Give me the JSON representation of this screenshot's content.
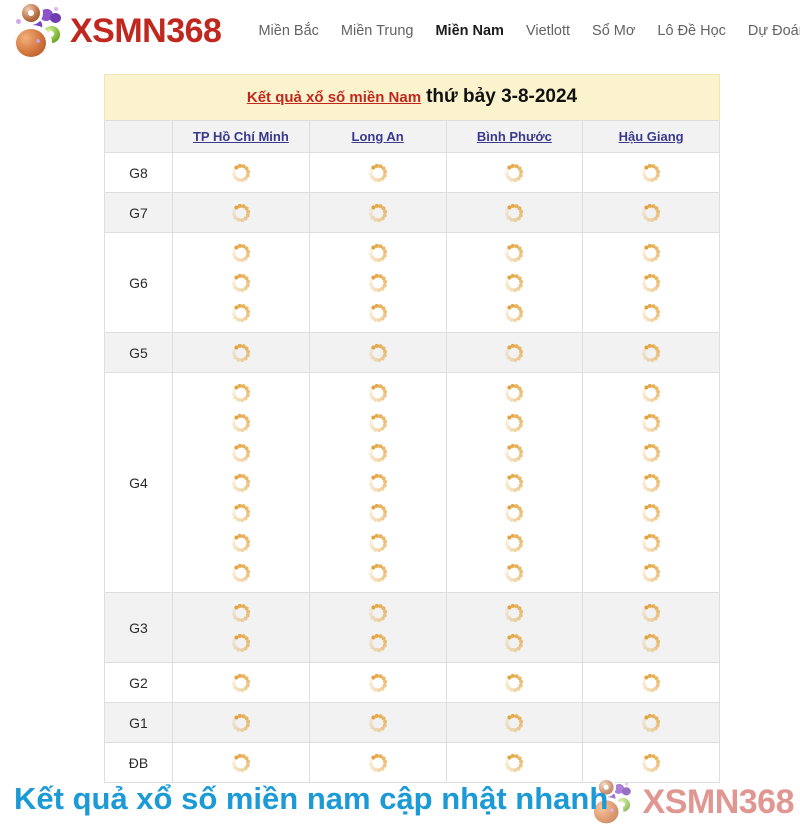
{
  "header": {
    "brand_name": "XSMN368",
    "brand_color": "#c0281f",
    "logo_icon": "lottery-balls-logo-icon",
    "nav": [
      {
        "label": "Miền Bắc",
        "active": false
      },
      {
        "label": "Miền Trung",
        "active": false
      },
      {
        "label": "Miền Nam",
        "active": true
      },
      {
        "label": "Vietlott",
        "active": false
      },
      {
        "label": "Sổ Mơ",
        "active": false
      },
      {
        "label": "Lô Đề Học",
        "active": false
      },
      {
        "label": "Dự Đoán",
        "active": false
      }
    ]
  },
  "result_panel": {
    "title_link": "Kết quả xổ số miền Nam",
    "title_date": "thứ bảy 3-8-2024",
    "title_bar_bg": "#faf3cd",
    "title_link_color": "#c0281f",
    "columns": [
      {
        "label": ""
      },
      {
        "label": "TP Hồ Chí Minh"
      },
      {
        "label": "Long An"
      },
      {
        "label": "Bình Phước"
      },
      {
        "label": "Hậu Giang"
      }
    ],
    "column_link_color": "#3a3a8c",
    "loading_icon": "loading-spinner-icon",
    "spinner_color": "#e2a33c",
    "rows": [
      {
        "prize": "G8",
        "count": 1,
        "shaded": false
      },
      {
        "prize": "G7",
        "count": 1,
        "shaded": true
      },
      {
        "prize": "G6",
        "count": 3,
        "shaded": false
      },
      {
        "prize": "G5",
        "count": 1,
        "shaded": true
      },
      {
        "prize": "G4",
        "count": 7,
        "shaded": false
      },
      {
        "prize": "G3",
        "count": 2,
        "shaded": true
      },
      {
        "prize": "G2",
        "count": 1,
        "shaded": false
      },
      {
        "prize": "G1",
        "count": 1,
        "shaded": true
      },
      {
        "prize": "ĐB",
        "count": 1,
        "shaded": false
      }
    ]
  },
  "bottom_banner": {
    "text": "Kết quả xổ số miền nam cập nhật nhanh",
    "text_color": "#1c9ad6",
    "watermark_text": "XSMN368",
    "watermark_icon": "lottery-balls-logo-icon"
  }
}
